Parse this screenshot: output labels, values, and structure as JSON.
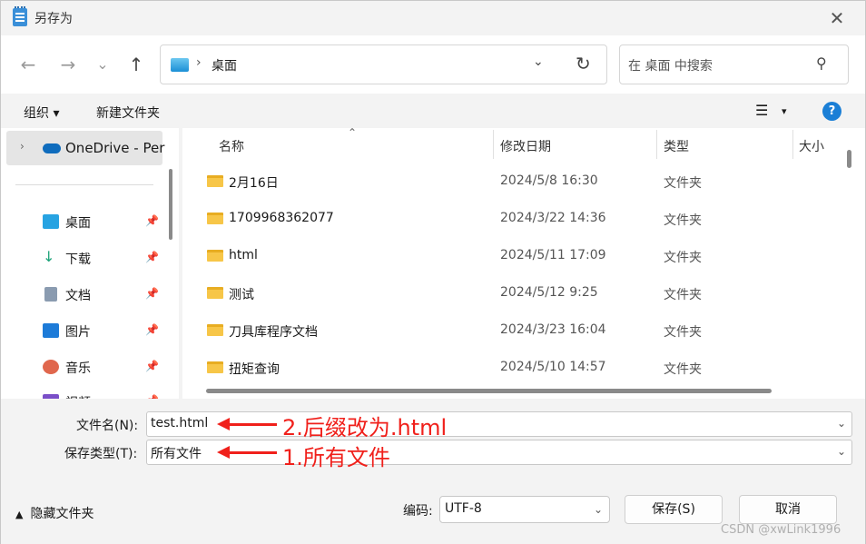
{
  "window": {
    "title": "另存为",
    "close": "✕"
  },
  "nav": {
    "back": "←",
    "forward": "→",
    "recent": "⌄",
    "up": "↑",
    "address": {
      "separator": "›",
      "path": "桌面",
      "dropdown": "⌄",
      "refresh": "↻"
    },
    "search": {
      "placeholder": "在 桌面 中搜索",
      "icon": "⚲"
    }
  },
  "toolbar": {
    "organize": "组织 ▾",
    "new_folder": "新建文件夹",
    "view": "☰",
    "view_dd": "▾",
    "help": "?"
  },
  "sidebar": {
    "onedrive": {
      "chevron": "›",
      "label": "OneDrive - Per"
    },
    "items": [
      {
        "label": "桌面",
        "icon": "desktop-icon",
        "color": "#27a3e2",
        "pin": "📌"
      },
      {
        "label": "下载",
        "icon": "download-icon",
        "color": "#1ea37a",
        "pin": "📌"
      },
      {
        "label": "文档",
        "icon": "document-icon",
        "color": "#8a9bb0",
        "pin": "📌"
      },
      {
        "label": "图片",
        "icon": "pictures-icon",
        "color": "#1d7bd8",
        "pin": "📌"
      },
      {
        "label": "音乐",
        "icon": "music-icon",
        "color": "#e0674d",
        "pin": "📌"
      },
      {
        "label": "视频",
        "icon": "video-icon",
        "color": "#7a4fc8",
        "pin": "📌"
      }
    ]
  },
  "columns": {
    "name": "名称",
    "date": "修改日期",
    "type": "类型",
    "size": "大小",
    "sort": "⌃"
  },
  "files": [
    {
      "name": "2月16日",
      "date": "2024/5/8 16:30",
      "type": "文件夹"
    },
    {
      "name": "1709968362077",
      "date": "2024/3/22 14:36",
      "type": "文件夹"
    },
    {
      "name": "html",
      "date": "2024/5/11 17:09",
      "type": "文件夹"
    },
    {
      "name": "测试",
      "date": "2024/5/12 9:25",
      "type": "文件夹"
    },
    {
      "name": "刀具库程序文档",
      "date": "2024/3/23 16:04",
      "type": "文件夹"
    },
    {
      "name": "扭矩查询",
      "date": "2024/5/10 14:57",
      "type": "文件夹"
    }
  ],
  "form": {
    "filename_label": "文件名(N):",
    "filename_value": "test.html",
    "filetype_label": "保存类型(T):",
    "filetype_value": "所有文件",
    "dropdown": "⌄",
    "annotation_1": "2.后缀改为.html",
    "annotation_2": "1.所有文件",
    "hide_folders": "隐藏文件夹",
    "hide_caret": "▲",
    "encoding_label": "编码:",
    "encoding_value": "UTF-8",
    "save": "保存(S)",
    "cancel": "取消"
  },
  "watermark": "CSDN @xwLink1996"
}
